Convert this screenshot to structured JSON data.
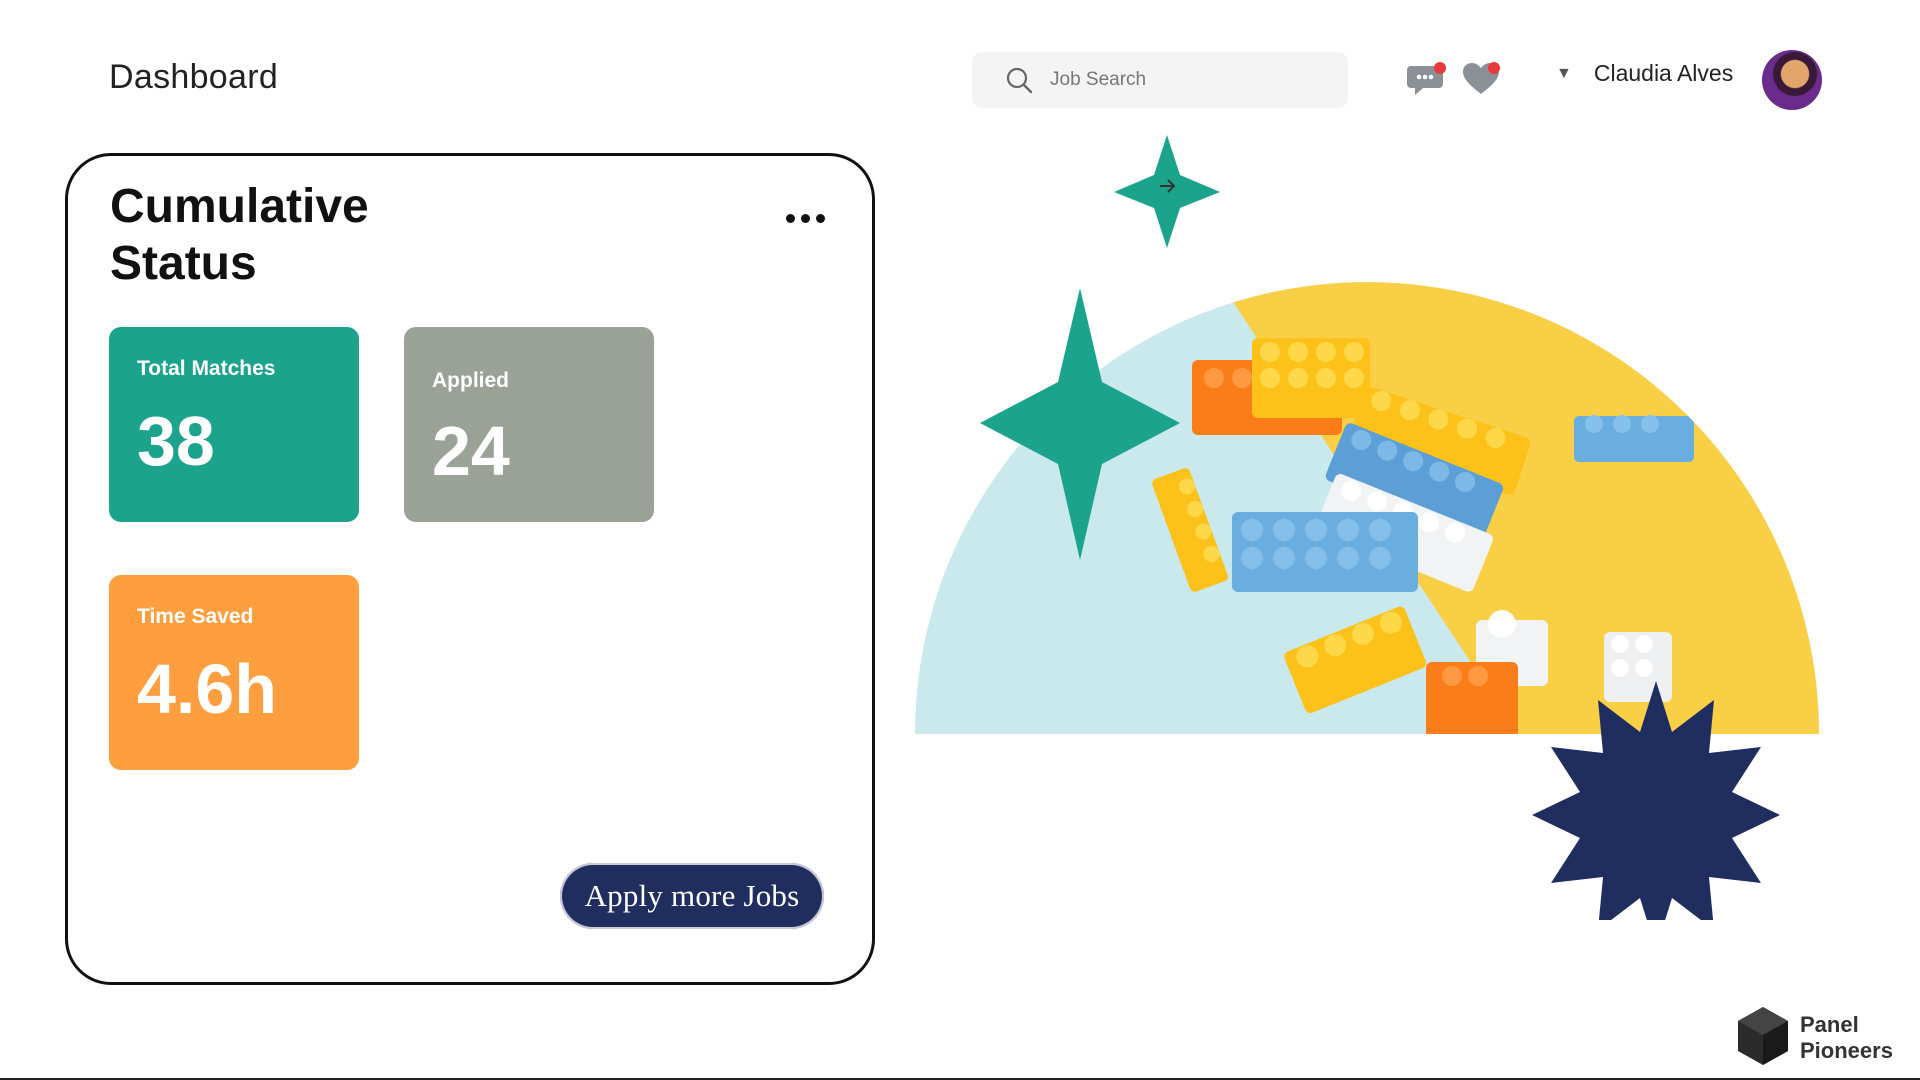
{
  "header": {
    "title": "Dashboard",
    "search_placeholder": "Job Search",
    "user_name": "Claudia Alves",
    "notifications": {
      "chat": true,
      "favorites": true
    }
  },
  "status_card": {
    "title": "Cumulative Status",
    "tiles": [
      {
        "label": "Total Matches",
        "value": "38",
        "color": "#1ba38b"
      },
      {
        "label": "Applied",
        "value": "24",
        "color": "#9aa197"
      },
      {
        "label": "Time Saved",
        "value": "4.6h",
        "color": "#fe9e3f"
      }
    ],
    "cta_label": "Apply more Jobs"
  },
  "brand": {
    "logo_text": "Panel Pioneers"
  },
  "colors": {
    "teal": "#1ba38b",
    "navy": "#1f2e5e",
    "orange": "#fe9e3f",
    "gray": "#9aa197",
    "notification": "#e83a3a"
  }
}
